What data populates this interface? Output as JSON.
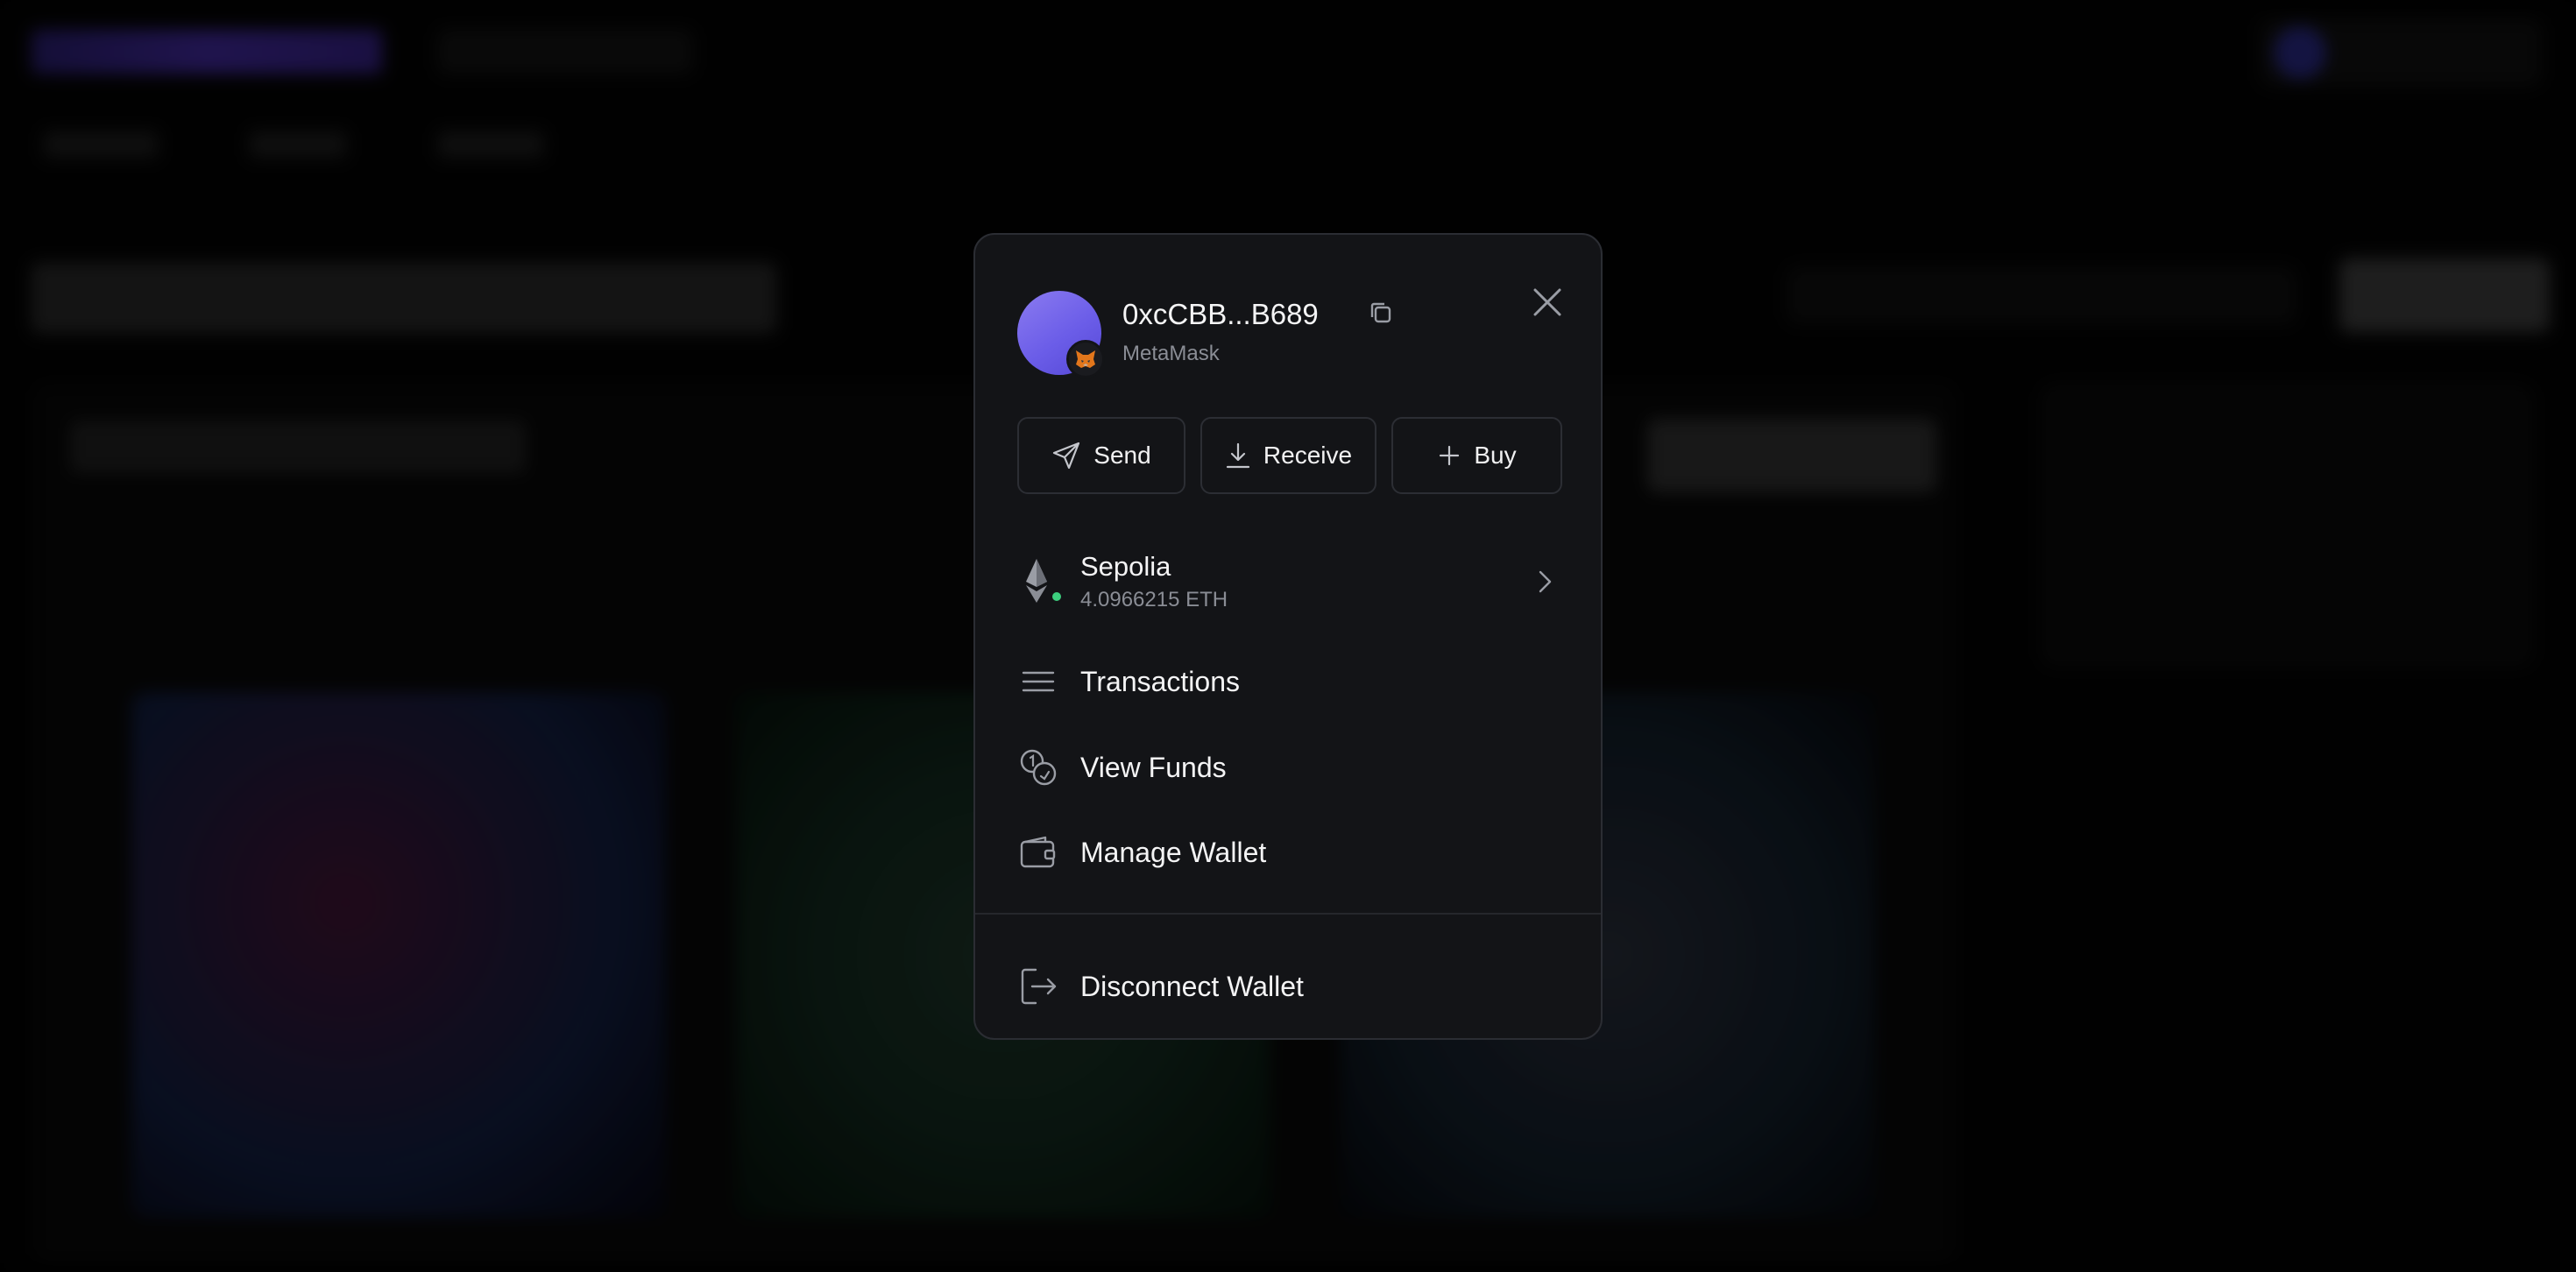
{
  "wallet": {
    "address": "0xcCBB...B689",
    "name": "MetaMask",
    "avatar_color": "#6b5de8"
  },
  "actions": {
    "send": "Send",
    "receive": "Receive",
    "buy": "Buy"
  },
  "network": {
    "name": "Sepolia",
    "balance": "4.0966215 ETH",
    "status_color": "#3ccf7e"
  },
  "menu": {
    "transactions": "Transactions",
    "view_funds": "View Funds",
    "manage_wallet": "Manage Wallet",
    "disconnect": "Disconnect Wallet"
  },
  "icons": {
    "close": "close-icon",
    "copy": "copy-icon",
    "send": "send-icon",
    "receive": "download-icon",
    "buy": "plus-icon",
    "network": "ethereum-icon",
    "chevron": "chevron-right-icon",
    "transactions": "list-icon",
    "view_funds": "coins-icon",
    "manage_wallet": "wallet-icon",
    "disconnect": "logout-icon"
  }
}
